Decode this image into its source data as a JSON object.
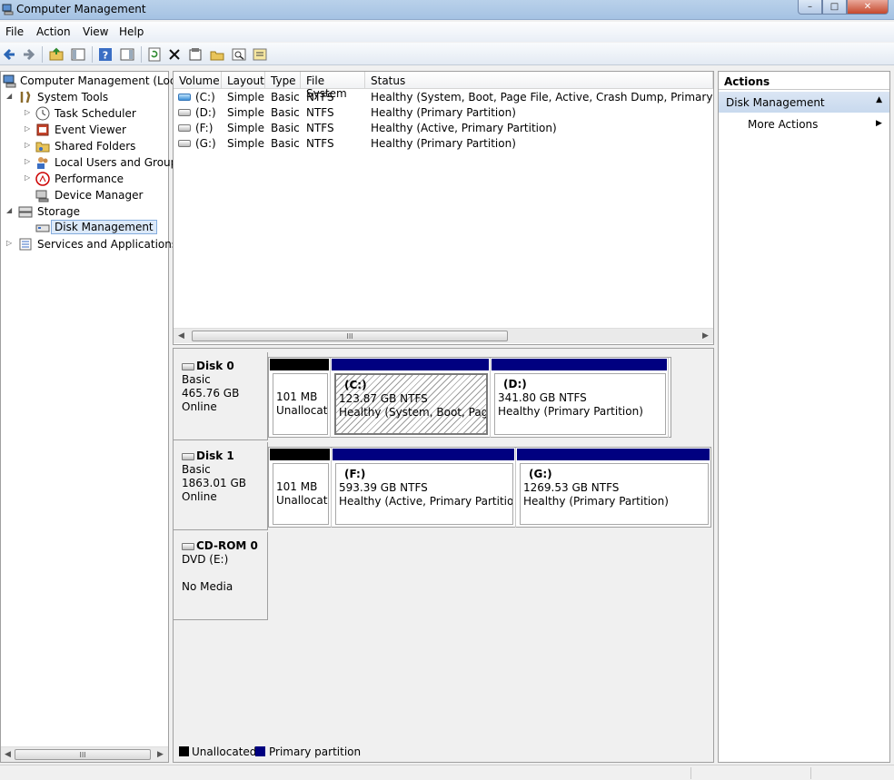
{
  "window": {
    "title": "Computer Management",
    "min": "–",
    "max": "□",
    "close": "✕"
  },
  "menu": [
    "File",
    "Action",
    "View",
    "Help"
  ],
  "toolbar": [
    "back-arrow-icon",
    "forward-arrow-icon",
    "up-folder-icon",
    "show-hide-tree-icon",
    "help-icon",
    "show-hide-action-pane-icon",
    "refresh-icon",
    "delete-icon",
    "properties-icon",
    "open-icon",
    "search-icon",
    "settings-icon"
  ],
  "tree": {
    "root": "Computer Management (Local",
    "system_tools": "System Tools",
    "task_scheduler": "Task Scheduler",
    "event_viewer": "Event Viewer",
    "shared_folders": "Shared Folders",
    "local_users": "Local Users and Groups",
    "performance": "Performance",
    "device_manager": "Device Manager",
    "storage": "Storage",
    "disk_management": "Disk Management",
    "services": "Services and Applications"
  },
  "list": {
    "headers": [
      "Volume",
      "Layout",
      "Type",
      "File System",
      "Status"
    ],
    "rows": [
      {
        "volume": "(C:)",
        "layout": "Simple",
        "type": "Basic",
        "fs": "NTFS",
        "status": "Healthy (System, Boot, Page File, Active, Crash Dump, Primary Partition"
      },
      {
        "volume": "(D:)",
        "layout": "Simple",
        "type": "Basic",
        "fs": "NTFS",
        "status": "Healthy (Primary Partition)"
      },
      {
        "volume": "(F:)",
        "layout": "Simple",
        "type": "Basic",
        "fs": "NTFS",
        "status": "Healthy (Active, Primary Partition)"
      },
      {
        "volume": "(G:)",
        "layout": "Simple",
        "type": "Basic",
        "fs": "NTFS",
        "status": "Healthy (Primary Partition)"
      }
    ],
    "scroll_grip": "III"
  },
  "disks": [
    {
      "name": "Disk 0",
      "kind": "Basic",
      "size": "465.76 GB",
      "state": "Online",
      "partitions": [
        {
          "kind": "unallocated",
          "size": "101 MB",
          "label": "",
          "status": "Unallocated"
        },
        {
          "kind": "primary",
          "label": "(C:)",
          "size": "123.87 GB NTFS",
          "status": "Healthy (System, Boot, Page File"
        },
        {
          "kind": "primary",
          "label": "(D:)",
          "size": "341.80 GB NTFS",
          "status": "Healthy (Primary Partition)"
        }
      ]
    },
    {
      "name": "Disk 1",
      "kind": "Basic",
      "size": "1863.01 GB",
      "state": "Online",
      "partitions": [
        {
          "kind": "unallocated",
          "size": "101 MB",
          "label": "",
          "status": "Unallocated"
        },
        {
          "kind": "primary",
          "label": "(F:)",
          "size": "593.39 GB NTFS",
          "status": "Healthy (Active, Primary Partition)"
        },
        {
          "kind": "primary",
          "label": "(G:)",
          "size": "1269.53 GB NTFS",
          "status": "Healthy (Primary Partition)"
        }
      ]
    },
    {
      "name": "CD-ROM 0",
      "kind": "DVD (E:)",
      "size": "",
      "state": "No Media",
      "partitions": []
    }
  ],
  "legend": {
    "unallocated": "Unallocated",
    "primary": "Primary partition",
    "unallocated_color": "#000000",
    "primary_color": "#000080"
  },
  "tree_scroll_grip": "III",
  "actions": {
    "header": "Actions",
    "section": "Disk Management",
    "more": "More Actions"
  }
}
